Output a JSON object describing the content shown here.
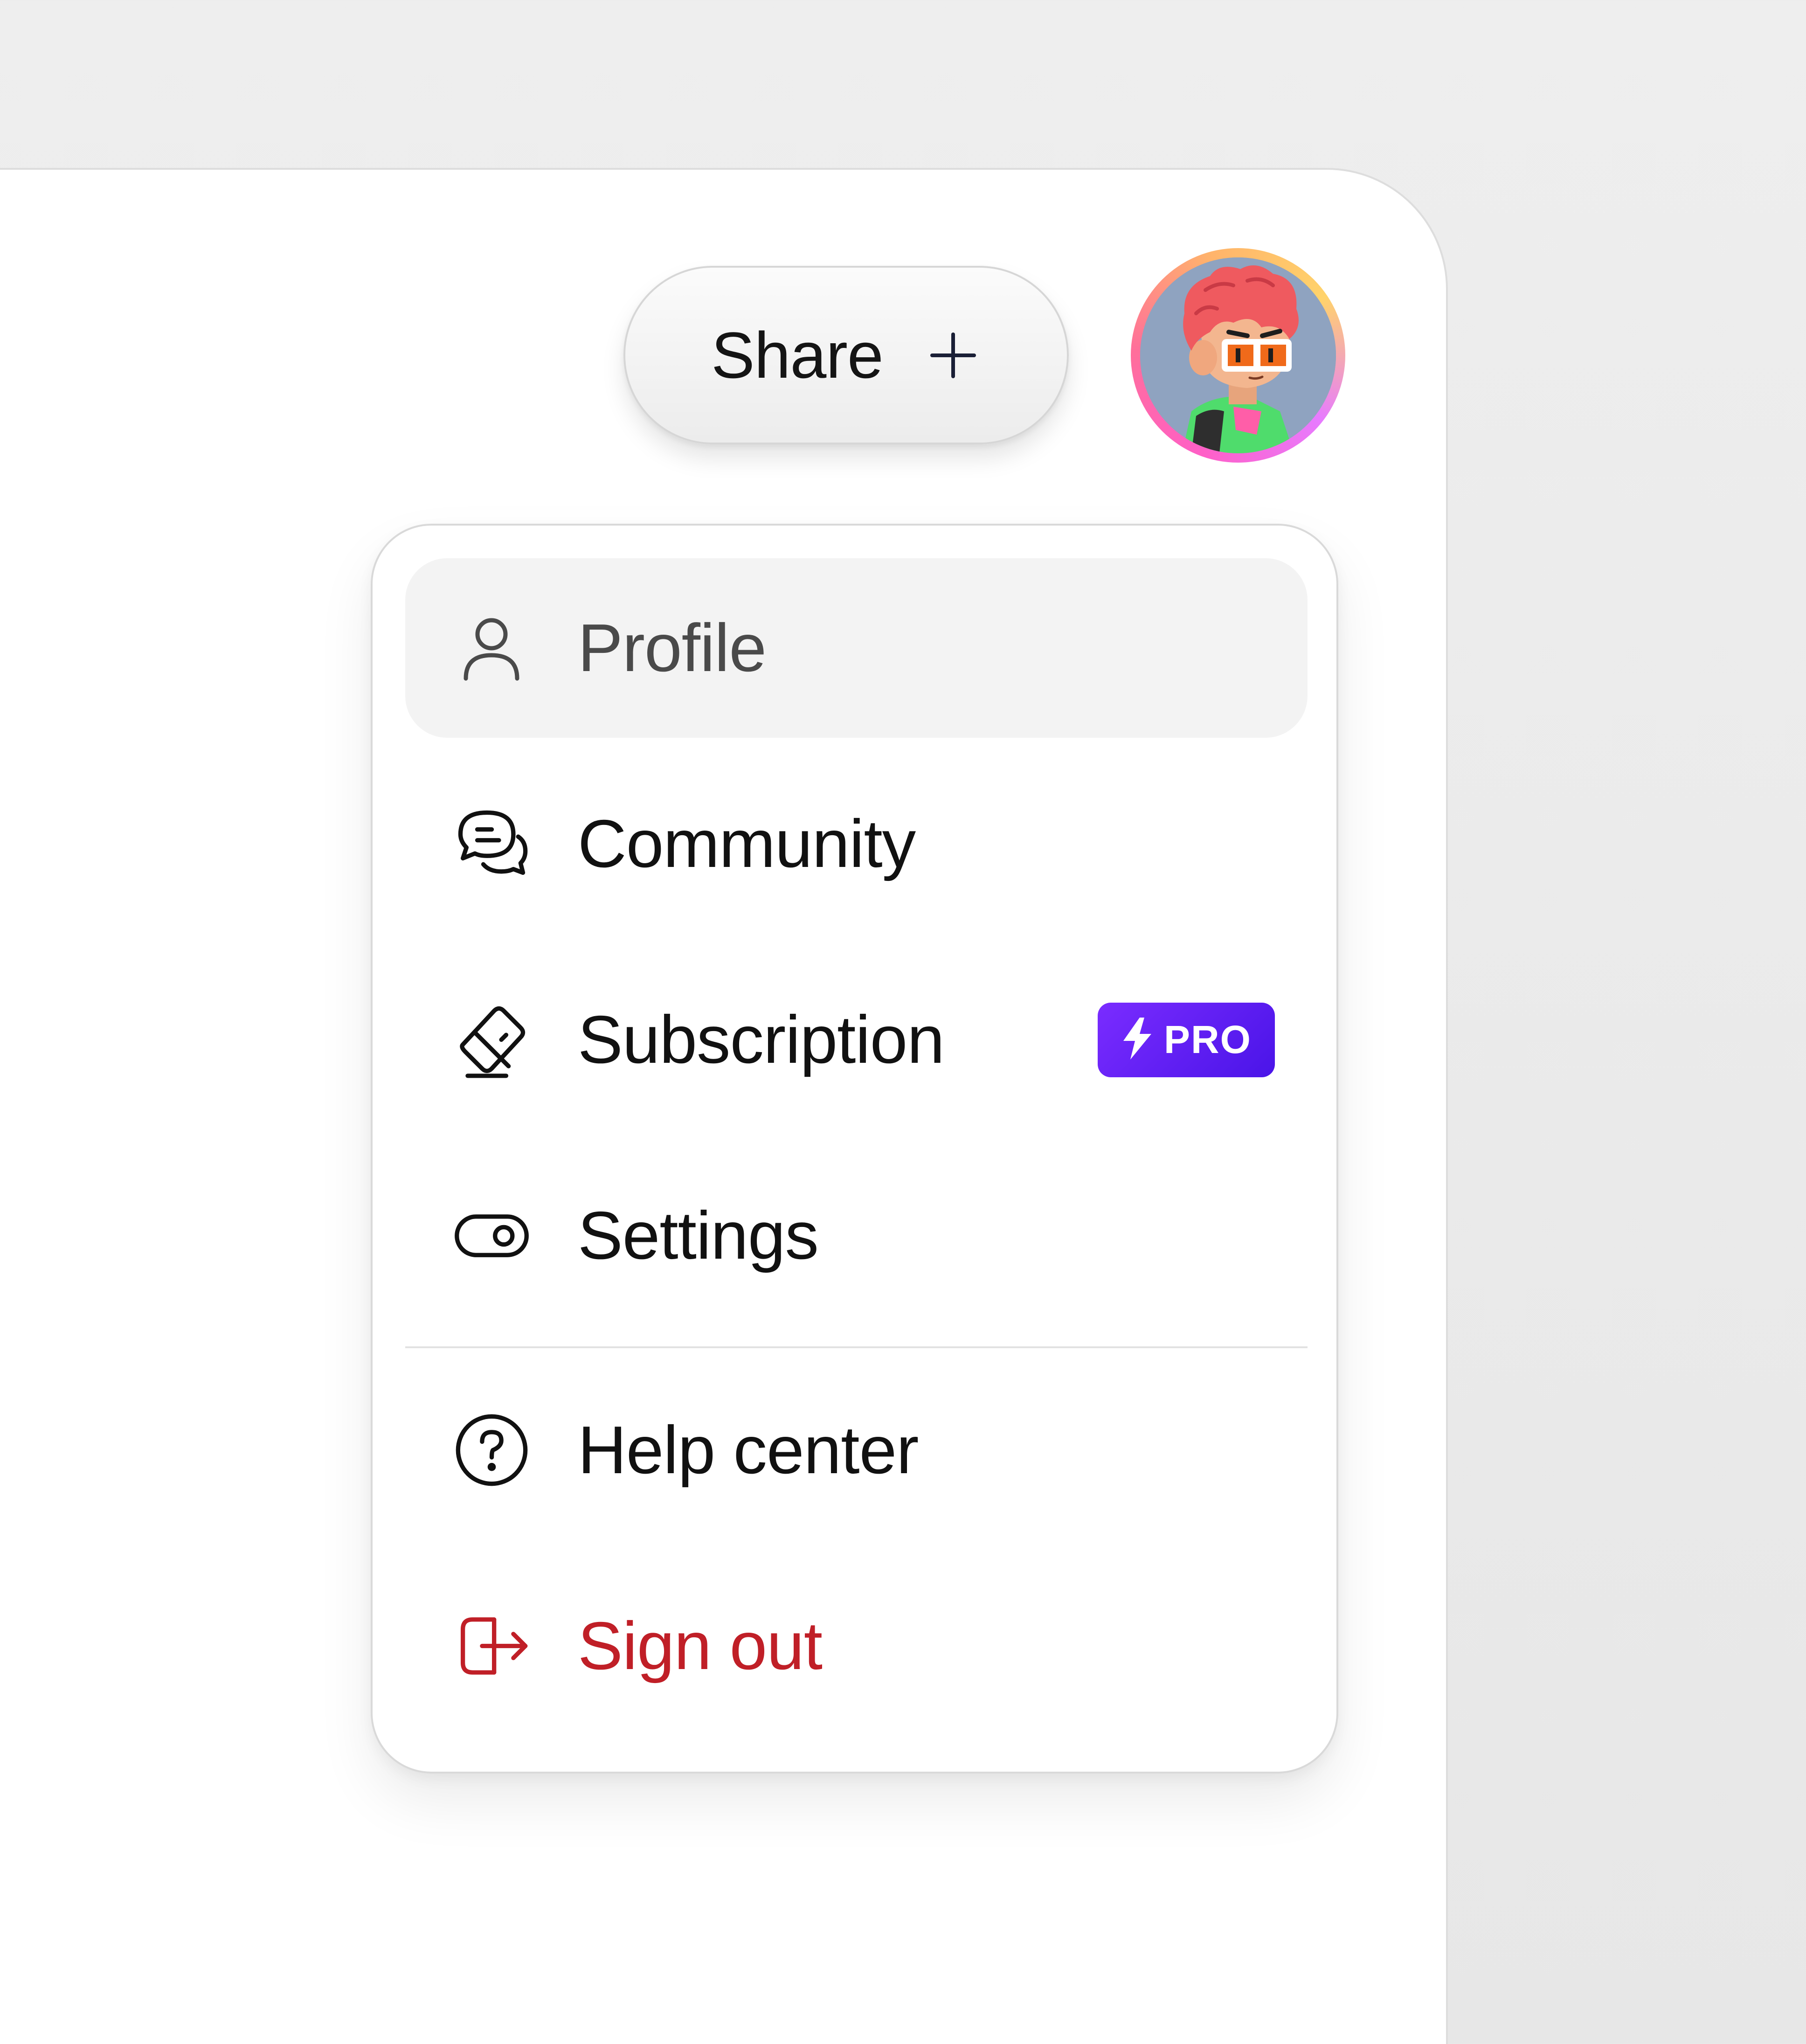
{
  "header": {
    "share_label": "Share",
    "share_icon": "plus-icon",
    "avatar_icon": "user-avatar"
  },
  "menu": {
    "items": [
      {
        "label": "Profile",
        "icon": "user-icon",
        "state": "hovered"
      },
      {
        "label": "Community",
        "icon": "chat-bubbles-icon"
      },
      {
        "label": "Subscription",
        "icon": "card-icon",
        "badge": "PRO"
      },
      {
        "label": "Settings",
        "icon": "toggle-icon"
      },
      {
        "label": "Help center",
        "icon": "question-circle-icon"
      },
      {
        "label": "Sign out",
        "icon": "logout-icon",
        "state": "danger"
      }
    ]
  },
  "colors": {
    "danger": "#c01f27",
    "badge_start": "#7a2cff",
    "badge_end": "#4a14e8",
    "hover_bg": "#f3f3f3"
  }
}
